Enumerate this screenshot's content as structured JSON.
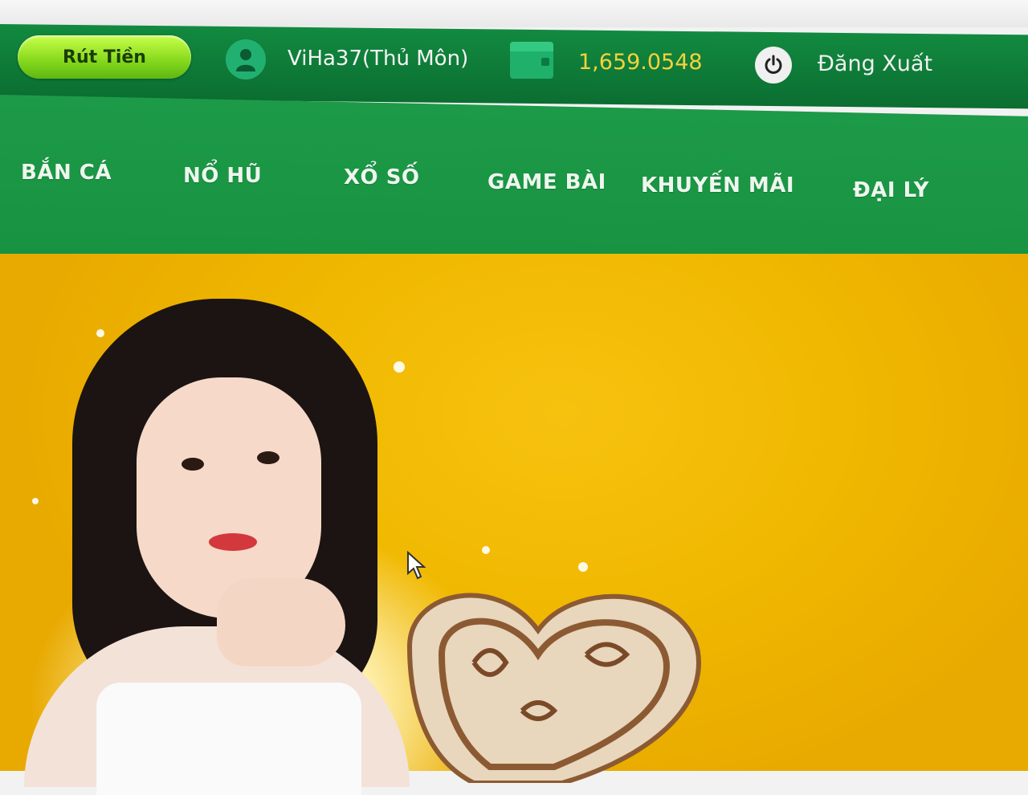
{
  "header": {
    "withdraw_label": "Rút Tiền",
    "username": "ViHa37(Thủ Môn)",
    "balance": "1,659.0548",
    "logout_label": "Đăng Xuất",
    "user_icon": "user-icon",
    "wallet_icon": "wallet-icon",
    "power_icon": "power-icon"
  },
  "nav": {
    "items": [
      {
        "label": "BẮN CÁ"
      },
      {
        "label": "NỔ HŨ"
      },
      {
        "label": "XỔ SỐ"
      },
      {
        "label": "GAME BÀI"
      },
      {
        "label": "KHUYẾN MÃI"
      },
      {
        "label": "ĐẠI LÝ"
      }
    ]
  },
  "colors": {
    "header_green": "#0b6e31",
    "nav_green": "#169140",
    "accent_lime": "#84d81c",
    "balance_gold": "#f5d23c",
    "banner_yellow": "#f0b800"
  }
}
